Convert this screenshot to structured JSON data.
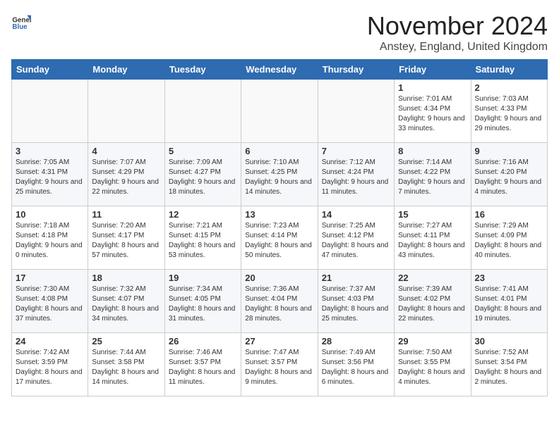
{
  "logo": {
    "general": "General",
    "blue": "Blue"
  },
  "header": {
    "month": "November 2024",
    "location": "Anstey, England, United Kingdom"
  },
  "days_of_week": [
    "Sunday",
    "Monday",
    "Tuesday",
    "Wednesday",
    "Thursday",
    "Friday",
    "Saturday"
  ],
  "weeks": [
    [
      {
        "day": "",
        "content": ""
      },
      {
        "day": "",
        "content": ""
      },
      {
        "day": "",
        "content": ""
      },
      {
        "day": "",
        "content": ""
      },
      {
        "day": "",
        "content": ""
      },
      {
        "day": "1",
        "content": "Sunrise: 7:01 AM\nSunset: 4:34 PM\nDaylight: 9 hours and 33 minutes."
      },
      {
        "day": "2",
        "content": "Sunrise: 7:03 AM\nSunset: 4:33 PM\nDaylight: 9 hours and 29 minutes."
      }
    ],
    [
      {
        "day": "3",
        "content": "Sunrise: 7:05 AM\nSunset: 4:31 PM\nDaylight: 9 hours and 25 minutes."
      },
      {
        "day": "4",
        "content": "Sunrise: 7:07 AM\nSunset: 4:29 PM\nDaylight: 9 hours and 22 minutes."
      },
      {
        "day": "5",
        "content": "Sunrise: 7:09 AM\nSunset: 4:27 PM\nDaylight: 9 hours and 18 minutes."
      },
      {
        "day": "6",
        "content": "Sunrise: 7:10 AM\nSunset: 4:25 PM\nDaylight: 9 hours and 14 minutes."
      },
      {
        "day": "7",
        "content": "Sunrise: 7:12 AM\nSunset: 4:24 PM\nDaylight: 9 hours and 11 minutes."
      },
      {
        "day": "8",
        "content": "Sunrise: 7:14 AM\nSunset: 4:22 PM\nDaylight: 9 hours and 7 minutes."
      },
      {
        "day": "9",
        "content": "Sunrise: 7:16 AM\nSunset: 4:20 PM\nDaylight: 9 hours and 4 minutes."
      }
    ],
    [
      {
        "day": "10",
        "content": "Sunrise: 7:18 AM\nSunset: 4:18 PM\nDaylight: 9 hours and 0 minutes."
      },
      {
        "day": "11",
        "content": "Sunrise: 7:20 AM\nSunset: 4:17 PM\nDaylight: 8 hours and 57 minutes."
      },
      {
        "day": "12",
        "content": "Sunrise: 7:21 AM\nSunset: 4:15 PM\nDaylight: 8 hours and 53 minutes."
      },
      {
        "day": "13",
        "content": "Sunrise: 7:23 AM\nSunset: 4:14 PM\nDaylight: 8 hours and 50 minutes."
      },
      {
        "day": "14",
        "content": "Sunrise: 7:25 AM\nSunset: 4:12 PM\nDaylight: 8 hours and 47 minutes."
      },
      {
        "day": "15",
        "content": "Sunrise: 7:27 AM\nSunset: 4:11 PM\nDaylight: 8 hours and 43 minutes."
      },
      {
        "day": "16",
        "content": "Sunrise: 7:29 AM\nSunset: 4:09 PM\nDaylight: 8 hours and 40 minutes."
      }
    ],
    [
      {
        "day": "17",
        "content": "Sunrise: 7:30 AM\nSunset: 4:08 PM\nDaylight: 8 hours and 37 minutes."
      },
      {
        "day": "18",
        "content": "Sunrise: 7:32 AM\nSunset: 4:07 PM\nDaylight: 8 hours and 34 minutes."
      },
      {
        "day": "19",
        "content": "Sunrise: 7:34 AM\nSunset: 4:05 PM\nDaylight: 8 hours and 31 minutes."
      },
      {
        "day": "20",
        "content": "Sunrise: 7:36 AM\nSunset: 4:04 PM\nDaylight: 8 hours and 28 minutes."
      },
      {
        "day": "21",
        "content": "Sunrise: 7:37 AM\nSunset: 4:03 PM\nDaylight: 8 hours and 25 minutes."
      },
      {
        "day": "22",
        "content": "Sunrise: 7:39 AM\nSunset: 4:02 PM\nDaylight: 8 hours and 22 minutes."
      },
      {
        "day": "23",
        "content": "Sunrise: 7:41 AM\nSunset: 4:01 PM\nDaylight: 8 hours and 19 minutes."
      }
    ],
    [
      {
        "day": "24",
        "content": "Sunrise: 7:42 AM\nSunset: 3:59 PM\nDaylight: 8 hours and 17 minutes."
      },
      {
        "day": "25",
        "content": "Sunrise: 7:44 AM\nSunset: 3:58 PM\nDaylight: 8 hours and 14 minutes."
      },
      {
        "day": "26",
        "content": "Sunrise: 7:46 AM\nSunset: 3:57 PM\nDaylight: 8 hours and 11 minutes."
      },
      {
        "day": "27",
        "content": "Sunrise: 7:47 AM\nSunset: 3:57 PM\nDaylight: 8 hours and 9 minutes."
      },
      {
        "day": "28",
        "content": "Sunrise: 7:49 AM\nSunset: 3:56 PM\nDaylight: 8 hours and 6 minutes."
      },
      {
        "day": "29",
        "content": "Sunrise: 7:50 AM\nSunset: 3:55 PM\nDaylight: 8 hours and 4 minutes."
      },
      {
        "day": "30",
        "content": "Sunrise: 7:52 AM\nSunset: 3:54 PM\nDaylight: 8 hours and 2 minutes."
      }
    ]
  ]
}
